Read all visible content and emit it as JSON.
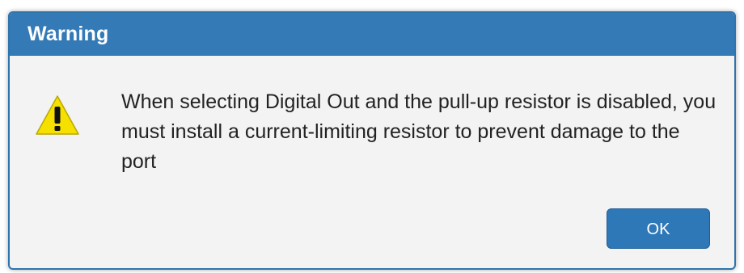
{
  "dialog": {
    "title": "Warning",
    "icon": "warning-triangle-icon",
    "message": "When selecting Digital Out and the pull-up resistor is disabled, you must install a current-limiting resistor to prevent damage to the port",
    "ok_label": "OK"
  },
  "colors": {
    "titlebar": "#337ab7",
    "button": "#2f78b8",
    "warning_fill": "#f5e000",
    "dialog_bg": "#f3f3f3"
  }
}
